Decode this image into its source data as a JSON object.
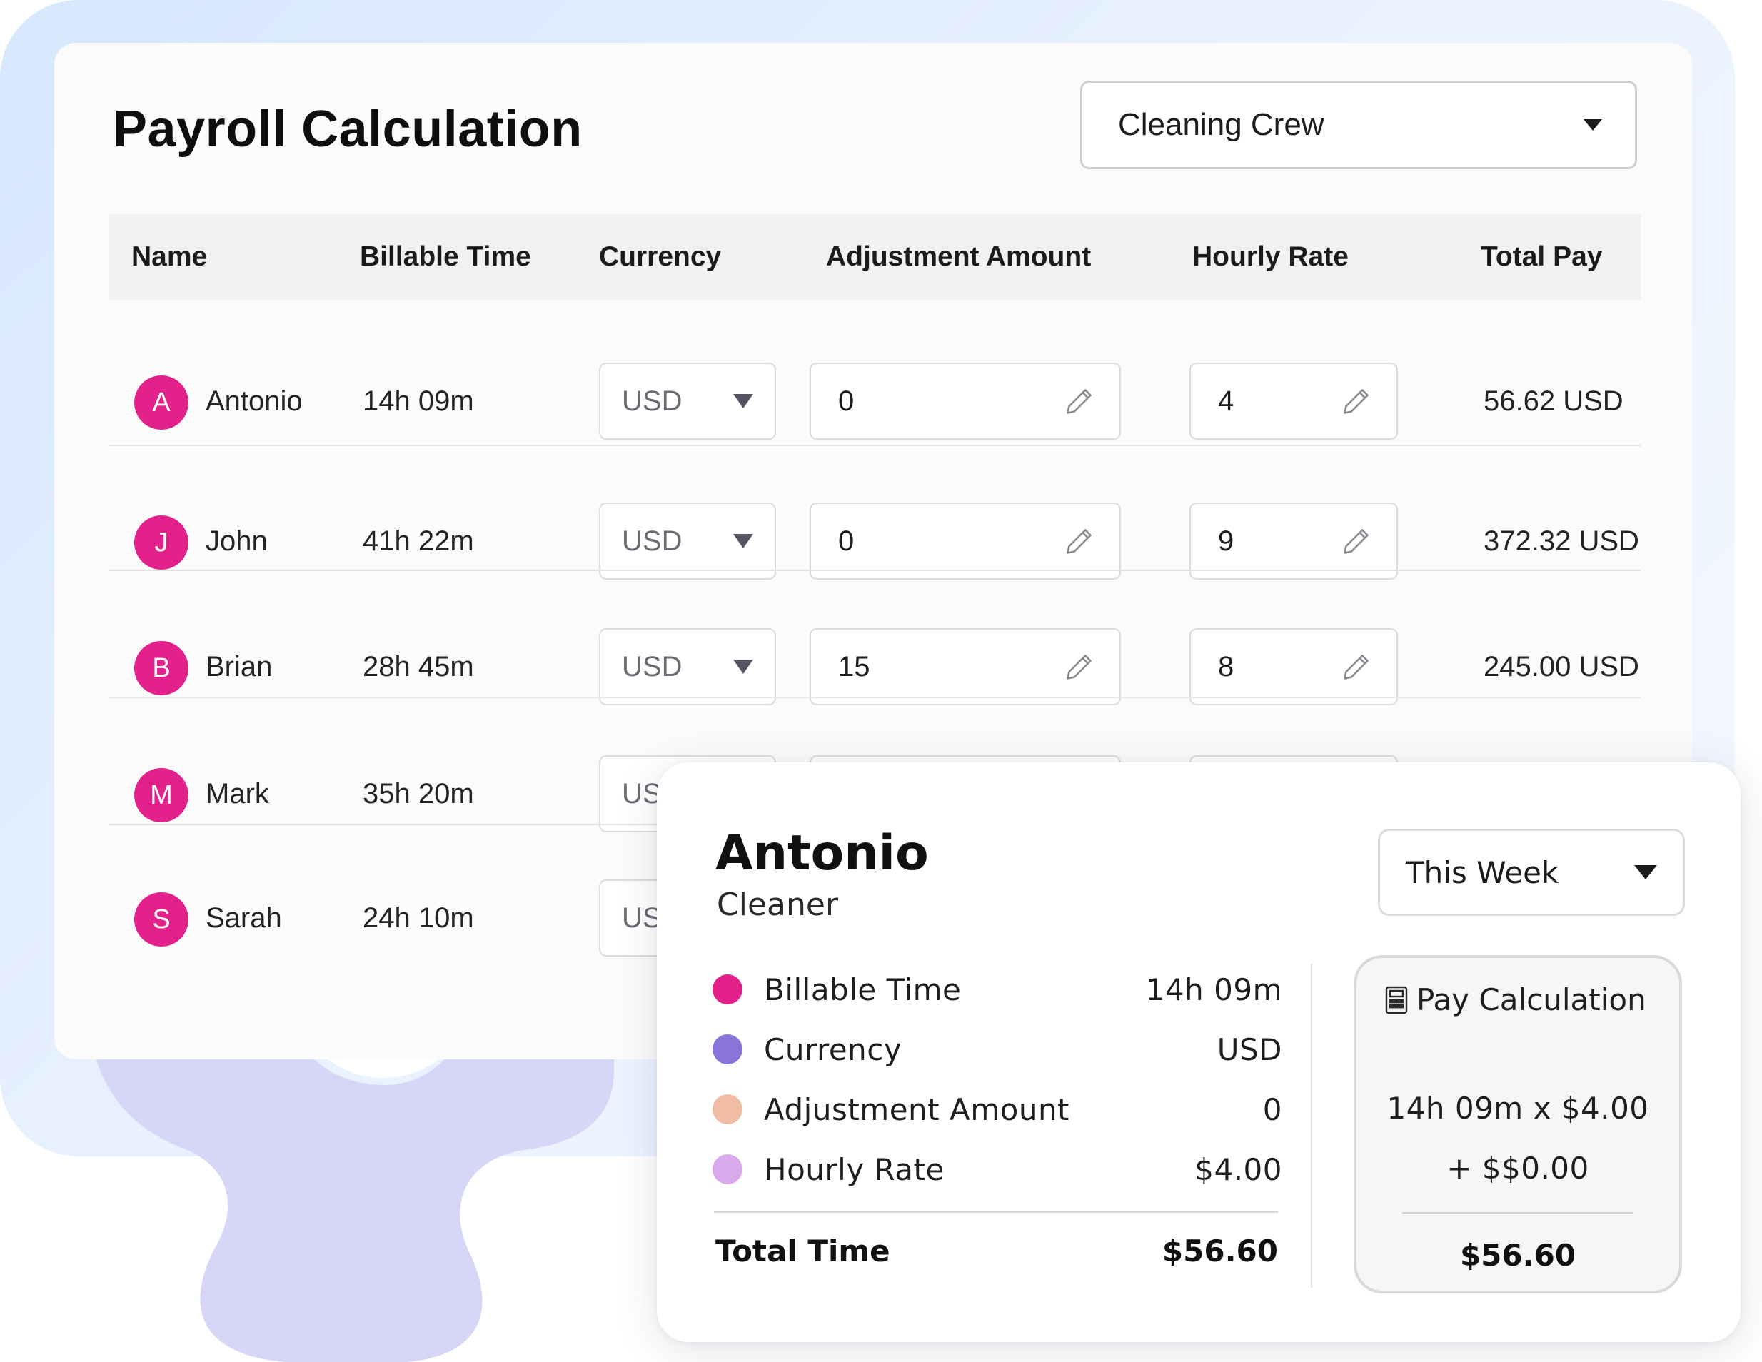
{
  "header": {
    "title": "Payroll Calculation",
    "team_select": "Cleaning Crew"
  },
  "table": {
    "columns": [
      "Name",
      "Billable Time",
      "Currency",
      "Adjustment Amount",
      "Hourly Rate",
      "Total Pay"
    ],
    "rows": [
      {
        "initial": "A",
        "name": "Antonio",
        "time": "14h 09m",
        "currency": "USD",
        "adjustment": "0",
        "rate": "4",
        "total": "56.62 USD"
      },
      {
        "initial": "J",
        "name": "John",
        "time": "41h 22m",
        "currency": "USD",
        "adjustment": "0",
        "rate": "9",
        "total": "372.32 USD"
      },
      {
        "initial": "B",
        "name": "Brian",
        "time": "28h 45m",
        "currency": "USD",
        "adjustment": "15",
        "rate": "8",
        "total": "245.00 USD"
      },
      {
        "initial": "M",
        "name": "Mark",
        "time": "35h 20m",
        "currency": "USD",
        "adjustment": "",
        "rate": "",
        "total": ""
      },
      {
        "initial": "S",
        "name": "Sarah",
        "time": "24h 10m",
        "currency": "US",
        "adjustment": "",
        "rate": "",
        "total": ""
      }
    ]
  },
  "detail": {
    "name": "Antonio",
    "role": "Cleaner",
    "period_select": "This Week",
    "stats": [
      {
        "label": "Billable Time",
        "value": "14h 09m",
        "color": "#e3218a"
      },
      {
        "label": "Currency",
        "value": "USD",
        "color": "#8b74d9"
      },
      {
        "label": "Adjustment Amount",
        "value": "0",
        "color": "#f0bda4"
      },
      {
        "label": "Hourly Rate",
        "value": "$4.00",
        "color": "#d9aaeb"
      }
    ],
    "total_label": "Total Time",
    "total_value": "$56.60",
    "calc": {
      "title": "Pay Calculation",
      "line1": "14h 09m x $4.00",
      "line2": "+ $$0.00",
      "result": "$56.60",
      "icon": "calculator-icon"
    }
  },
  "colors": {
    "avatar": "#e3218a",
    "background_gradient": "#d6e7ff",
    "gear": "#d6d7f7"
  }
}
